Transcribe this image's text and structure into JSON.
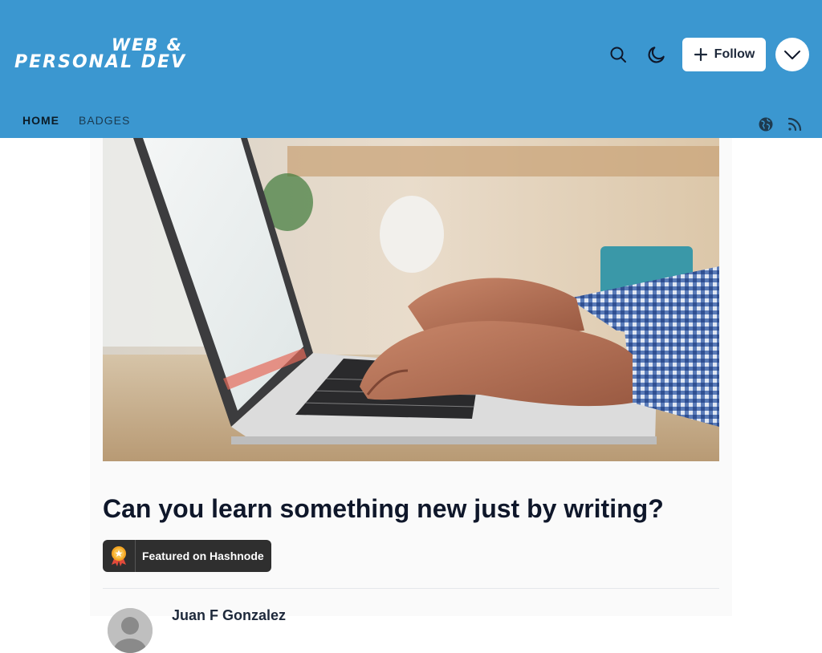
{
  "header": {
    "logo_line1": "WEB &",
    "logo_line2": "PERSONAL DEV",
    "follow_label": "Follow",
    "icons": [
      "search-icon",
      "moon-icon",
      "plus-icon",
      "chevron-down-icon",
      "globe-icon",
      "rss-icon"
    ],
    "background_color": "#3b97d0"
  },
  "nav": {
    "items": [
      {
        "label": "HOME",
        "active": true
      },
      {
        "label": "BADGES",
        "active": false
      }
    ]
  },
  "article": {
    "title": "Can you learn something new just by writing?",
    "badge_label": "Featured on Hashnode",
    "author_name": "Juan F Gonzalez"
  }
}
